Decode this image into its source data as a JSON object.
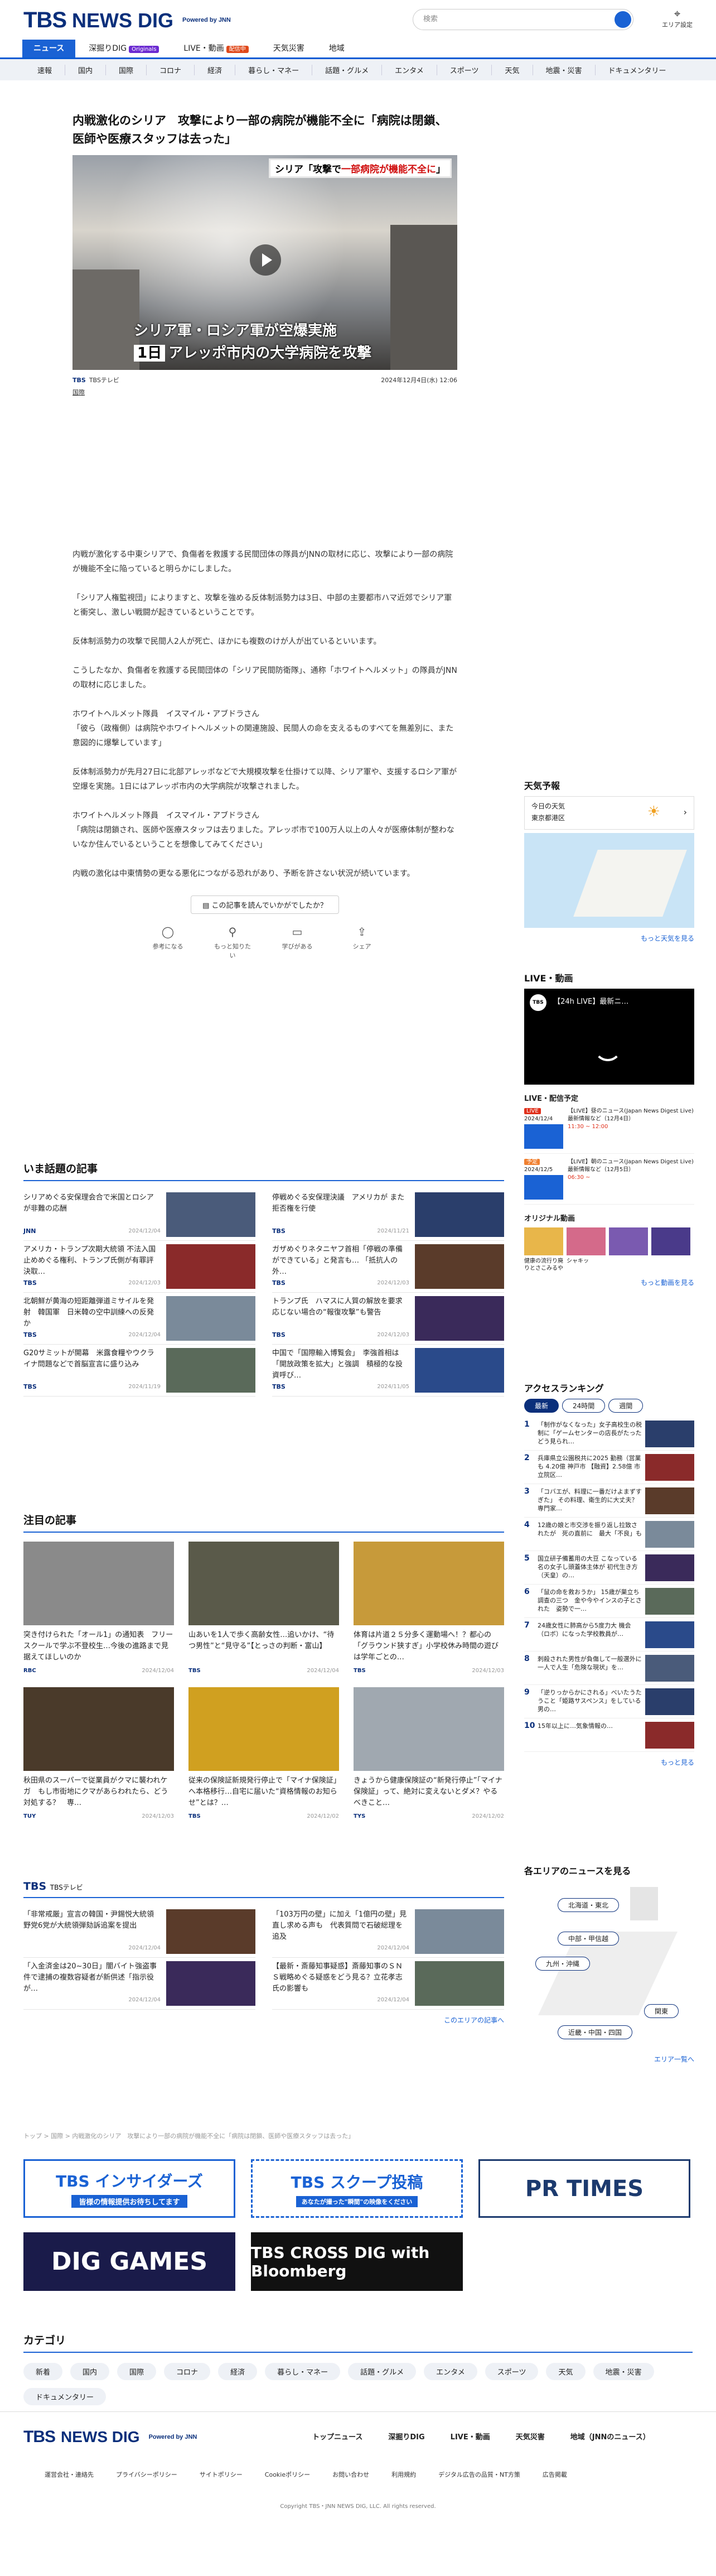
{
  "header": {
    "logo_tbs": "TBS",
    "logo_news": "NEWS DIG",
    "powered": "Powered by JNN",
    "search_placeholder": "検索",
    "area_label": "エリア設定"
  },
  "nav": {
    "items": [
      {
        "label": "ニュース"
      },
      {
        "label": "深掘りDIG",
        "tag": "Originals"
      },
      {
        "label": "LIVE・動画",
        "tag": "配信中"
      },
      {
        "label": "天気災害"
      },
      {
        "label": "地域"
      }
    ]
  },
  "subnav": [
    "速報",
    "国内",
    "国際",
    "コロナ",
    "経済",
    "暮らし・マネー",
    "話題・グルメ",
    "エンタメ",
    "スポーツ",
    "天気",
    "地震・災害",
    "ドキュメンタリー"
  ],
  "article": {
    "title": "内戦激化のシリア　攻撃により一部の病院が機能不全に「病院は閉鎖、医師や医療スタッフは去った」",
    "video_caption_top_pre": "シリア「攻撃で",
    "video_caption_top_red": "一部病院が機能不全に",
    "video_caption_top_post": "」",
    "video_caption_1": "シリア軍・ロシア軍が空爆実施",
    "video_caption_2_day": "1日",
    "video_caption_2": "アレッポ市内の大学病院を攻撃",
    "source": "TBS",
    "source_name": "TBSテレビ",
    "date": "2024年12月4日(水) 12:06",
    "tag": "国際",
    "paragraphs": [
      "内戦が激化する中東シリアで、負傷者を救護する民間団体の隊員がJNNの取材に応じ、攻撃により一部の病院が機能不全に陥っていると明らかにしました。",
      "「シリア人権監視団」によりますと、攻撃を強める反体制派勢力は3日、中部の主要都市ハマ近郊でシリア軍と衝突し、激しい戦闘が起きているということです。",
      "反体制派勢力の攻撃で民間人2人が死亡、ほかにも複数のけが人が出ているといいます。",
      "こうしたなか、負傷者を救護する民間団体の「シリア民間防衛隊」、通称「ホワイトヘルメット」の隊員がJNNの取材に応じました。",
      "ホワイトヘルメット隊員　イスマイル・アブドラさん\n「彼ら（政権側）は病院やホワイトヘルメットの関連施設、民間人の命を支えるものすべてを無差別に、また意図的に爆撃しています」",
      "反体制派勢力が先月27日に北部アレッポなどで大規模攻撃を仕掛けて以降、シリア軍や、支援するロシア軍が空爆を実施。1日にはアレッポ市内の大学病院が攻撃されました。",
      "ホワイトヘルメット隊員　イスマイル・アブドラさん\n「病院は閉鎖され、医師や医療スタッフは去りました。アレッポ市で100万人以上の人々が医療体制が整わないなか住んでいるということを想像してみてください」",
      "内戦の激化は中東情勢の更なる悪化につながる恐れがあり、予断を許さない状況が続いています。"
    ],
    "feedback_q": "この記事を読んでいかがでしたか？",
    "feedback_opts": [
      "参考になる",
      "もっと知りたい",
      "学びがある",
      "シェア"
    ]
  },
  "hot": {
    "title": "いま話題の記事",
    "items": [
      {
        "t": "シリアめぐる安保理会合で米国とロシアが非難の応酬",
        "s": "JNN",
        "d": "2024/12/04"
      },
      {
        "t": "停戦めぐる安保理決議　アメリカが また拒否権を行使",
        "s": "TBS",
        "d": "2024/11/21"
      },
      {
        "t": "アメリカ・トランプ次期大統領 不法入国止めめぐる権利、トランプ氏側が有罪評決取…",
        "s": "TBS",
        "d": "2024/12/03"
      },
      {
        "t": "ガザめぐりネタニヤフ首相「停戦の準備ができている」と発言も… 「抵抗人の外…",
        "s": "TBS",
        "d": "2024/12/03"
      },
      {
        "t": "北朝鮮が黄海の短距離弾道ミサイルを発射　韓国軍　日米韓の空中訓練への反発か",
        "s": "TBS",
        "d": "2024/12/04"
      },
      {
        "t": "トランプ氏　ハマスに人質の解放を要求　応じない場合の“報復攻撃”も警告",
        "s": "TBS",
        "d": "2024/12/03"
      },
      {
        "t": "G20サミットが開幕　米露食糧やウクライナ問題などで首脳宣言に盛り込み",
        "s": "TBS",
        "d": "2024/11/19"
      },
      {
        "t": "中国で「国際輸入博覧会」　李強首相は「開放政策を拡大」と強調　積極的な投資呼び…",
        "s": "TBS",
        "d": "2024/11/05"
      }
    ]
  },
  "notice": {
    "title": "注目の記事",
    "items": [
      {
        "t": "突き付けられた「オール1」の通知表　フリースクールで学ぶ不登校生…今後の進路まで見据えてほしいのか",
        "s": "RBC",
        "d": "2024/12/04"
      },
      {
        "t": "山あいを1人で歩く高齢女性…追いかけ、“待つ男性”と“見守る”【とっさの判断・富山】",
        "s": "TBS",
        "d": "2024/12/04"
      },
      {
        "t": "体育は片道２５分多く運動場へ！？都心の「グラウンド狭すぎ」小学校休み時間の遊びは学年ごとの…",
        "s": "TBS",
        "d": "2024/12/03"
      },
      {
        "t": "秋田県のスーパーで従業員がクマに襲われケガ　もし市街地にクマがあらわれたら、どう対処する？　専…",
        "s": "TUY",
        "d": "2024/12/03"
      },
      {
        "t": "従来の保険証新規発行停止で「マイナ保険証」へ本格移行…自宅に届いた“資格情報のお知らせ”とは？…",
        "s": "TBS",
        "d": "2024/12/02"
      },
      {
        "t": "きょうから健康保険証の“新発行停止”「マイナ保険証」って、絶対に変えないとダメ？やるべきこと…",
        "s": "TYS",
        "d": "2024/12/02"
      }
    ]
  },
  "tbs": {
    "title": "TBSテレビ",
    "items": [
      {
        "t": "「非常戒厳」宣言の韓国・尹錫悦大統領　野党6党が大統領弾劾訴追案を提出",
        "d": "2024/12/04"
      },
      {
        "t": "「103万円の壁」に加え「1億円の壁」見直し求める声も　代表質問で石破総理を追及",
        "d": "2024/12/04"
      },
      {
        "t": "「入金済金は20~30日」闇バイト強盗事件で逮捕の複数容疑者が新供述「指示役が…",
        "d": "2024/12/04"
      },
      {
        "t": "【最新・斎藤知事疑惑】斎藤知事のＳＮＳ戦略めぐる疑惑をどう見る？立花孝志氏の影響も",
        "d": "2024/12/04"
      }
    ],
    "more": "このエリアの記事へ"
  },
  "side": {
    "weather_title": "天気予報",
    "weather_today": "今日の天気",
    "weather_place": "東京都港区",
    "weather_more": "もっと天気を見る",
    "live_title": "LIVE・動画",
    "live_video": "【24h LIVE】最新ニ…",
    "live_schedule": "LIVE・配信予定",
    "live_items": [
      {
        "tag": "LIVE",
        "date": "2024/12/4",
        "t": "【LIVE】昼のニュース(Japan News Digest Live)最新情報など（12月4日）",
        "time": "11:30 ~ 12:00"
      },
      {
        "tag": "予定",
        "date": "2024/12/5",
        "t": "【LIVE】朝のニュース(Japan News Digest Live) 最新情報など（12月5日）",
        "time": "06:30 ~ "
      }
    ],
    "orig_title": "オリジナル動画",
    "orig_items": [
      "健康の流行り廃りとさこみるや",
      "シャキッ",
      "",
      ""
    ],
    "orig_more": "もっと動画を見る",
    "rank_title": "アクセスランキング",
    "rank_tabs": [
      "最新",
      "24時間",
      "週間"
    ],
    "ranks": [
      "「制作がなくなった」女子高校生の税制に「ゲームセンターの店長がたったどう見られ…",
      "兵庫県立公園税共に2025 勤務（営業も 4.20億 神戸市 【融資】2.58億 市立院区…",
      "「コバエが、料理に一番だけよまずすぎた」 その料理、衛生的に大丈夫？専門家…",
      "12歳の娘と市交渉を振り返し拉致されたが　死の直前に　最大「不良」も",
      "国立研子備蓄用の大豆 こなっている名の女子し頭蓋体主体が 初代生き方（天皇）の…",
      "「鼠の命を救おうか」 15歳が巣立ち調查の三つ　金や今やインスの子とされた　姿勢で一…",
      "24歳女性に肺高から5度力大 機会（ロボ）になった学校教員が…",
      "刺殺された男性が負傷して一般選外に一人で人生「危険な現状」を…",
      "「逆りっからかにされる」べいたうたうこと「姫路サスペンス」をしている男の…",
      "15年以上に…気象情報の…"
    ],
    "rank_more": "もっと見る",
    "region_title": "各エリアのニュースを見る",
    "regions": [
      "北海道・東北",
      "中部・甲信越",
      "九州・沖縄",
      "関東",
      "近畿・中国・四国"
    ],
    "region_more": "エリア一覧へ"
  },
  "breadcrumb": "トップ > 国際 > 内戦激化のシリア　攻撃により一部の病院が機能不全に「病院は閉鎖、医師や医療スタッフは去った」",
  "banners": [
    "TBS インサイダーズ",
    "TBS スクープ投稿",
    "PR TIMES",
    "DIG GAMES",
    "TBS CROSS DIG with Bloomberg"
  ],
  "banner_subs": [
    "皆様の情報提供お待ちしてます",
    "あなたが撮った\"瞬間\"の映像をください"
  ],
  "categories": {
    "title": "カテゴリ",
    "items": [
      "新着",
      "国内",
      "国際",
      "コロナ",
      "経済",
      "暮らし・マネー",
      "話題・グルメ",
      "エンタメ",
      "スポーツ",
      "天気",
      "地震・災害",
      "ドキュメンタリー"
    ]
  },
  "footer": {
    "nav": [
      "トップニュース",
      "深掘りDIG",
      "LIVE・動画",
      "天気災害",
      "地域（JNNのニュース）"
    ],
    "links": [
      "運営会社・連絡先",
      "プライバシーポリシー",
      "サイトポリシー",
      "Cookieポリシー",
      "お問い合わせ",
      "利用規約",
      "デジタル広告の品質・NT方策",
      "広告掲載"
    ],
    "copyright": "Copyright TBS・JNN NEWS DIG, LLC. All rights reserved."
  }
}
